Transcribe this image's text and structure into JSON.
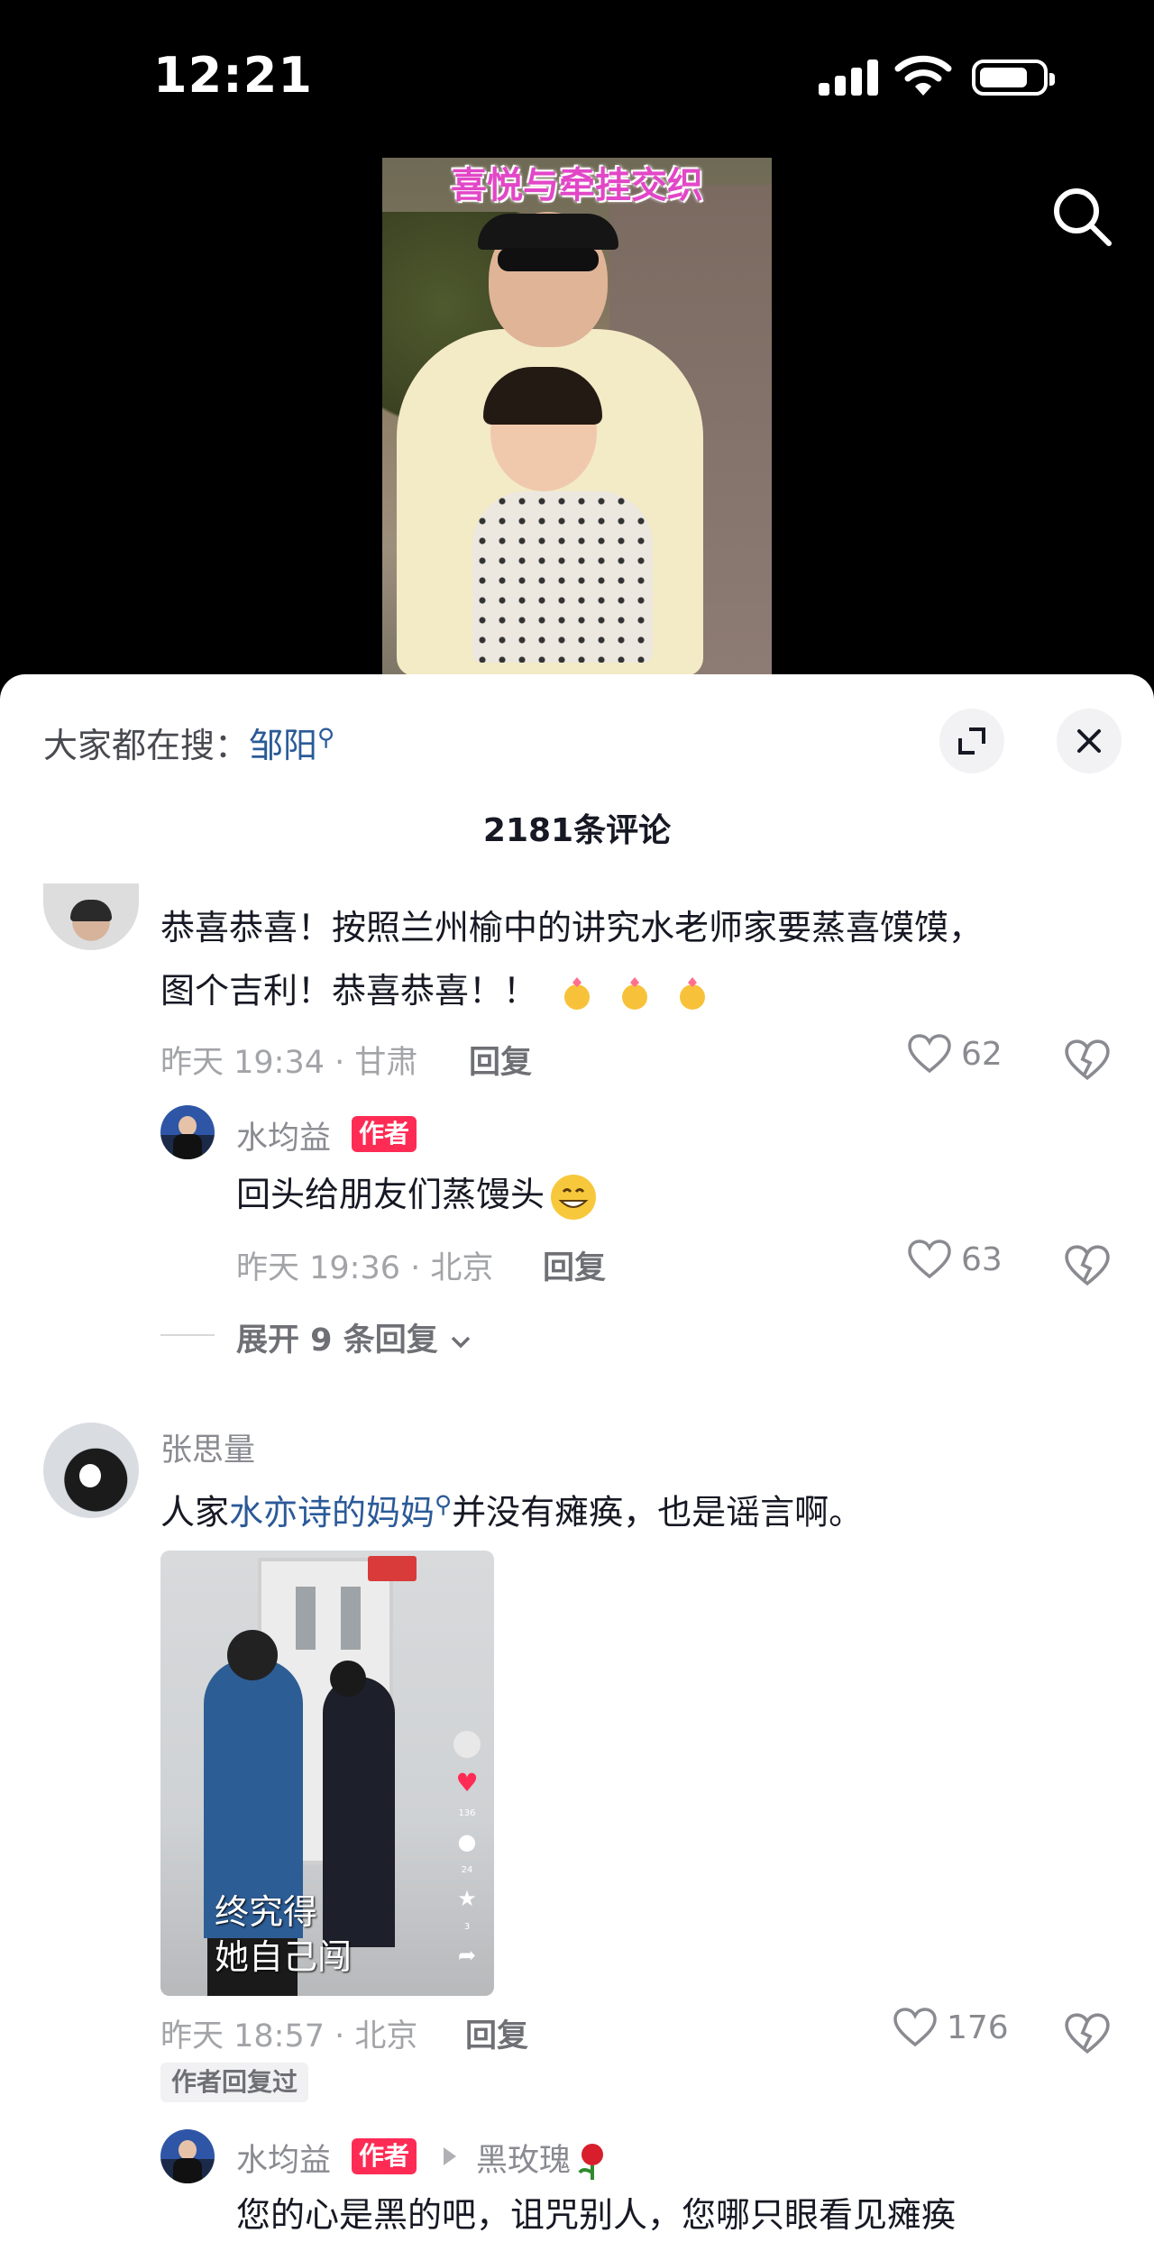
{
  "status_bar": {
    "time": "12:21"
  },
  "video": {
    "overlay_title": "喜悦与牵挂交织"
  },
  "sheet": {
    "hot_search_prefix": "大家都在搜：",
    "hot_search_keyword": "邹阳",
    "comment_count_title": "2181条评论"
  },
  "comments": [
    {
      "text_line1": "恭喜恭喜！按照兰州榆中的讲究水老师家要蒸喜馍馍，",
      "text_line2": "图个吉利！恭喜恭喜！！",
      "time_location": "昨天 19:34 · 甘肃",
      "reply_label": "回复",
      "likes": "62",
      "replies": [
        {
          "user": "水均益",
          "tag": "作者",
          "text": "回头给朋友们蒸馒头",
          "time_location": "昨天 19:36 · 北京",
          "reply_label": "回复",
          "likes": "63"
        }
      ],
      "expand_label": "展开 9 条回复"
    },
    {
      "user": "张思量",
      "text_before": "人家",
      "text_link": "水亦诗的妈妈",
      "text_after": "并没有瘫痪，也是谣言啊。",
      "image_caption_line1": "终究得",
      "image_caption_line2": "她自己闯",
      "image_side_counts": [
        "136",
        "24",
        "3"
      ],
      "time_location": "昨天 18:57 · 北京",
      "reply_label": "回复",
      "likes": "176",
      "badge": "作者回复过",
      "replies": [
        {
          "user": "水均益",
          "tag": "作者",
          "reply_to": "黑玫瑰",
          "text": "您的心是黑的吧，诅咒别人，您哪只眼看见瘫痪"
        }
      ]
    }
  ],
  "colors": {
    "accent": "#fe2c55",
    "link": "#2b5a98",
    "meta": "#a3a4a8"
  },
  "icons": [
    "search-icon",
    "expand-icon",
    "close-icon",
    "heart-icon",
    "dislike-icon",
    "chevron-down-icon",
    "search-keyword-icon",
    "triangle-right-icon",
    "rose-emoji"
  ]
}
